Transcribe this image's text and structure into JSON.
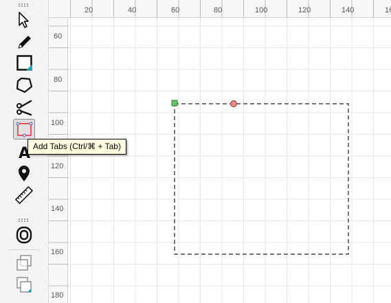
{
  "tooltip": {
    "text": "Add Tabs (Ctrl/⌘ + Tab)"
  },
  "ruler": {
    "x_ticks": [
      "20",
      "40",
      "60",
      "80",
      "100",
      "120",
      "140",
      "16"
    ],
    "y_ticks": [
      "60",
      "80",
      "100",
      "120",
      "140",
      "160",
      "180"
    ]
  },
  "toolbar": {
    "tools": [
      {
        "icon": "select-arrow-icon"
      },
      {
        "icon": "pencil-icon"
      },
      {
        "icon": "rectangle-icon"
      },
      {
        "icon": "polygon-icon"
      },
      {
        "icon": "scissors-icon"
      },
      {
        "icon": "add-tabs-icon",
        "active": true
      },
      {
        "icon": "text-icon"
      },
      {
        "icon": "map-pin-icon"
      },
      {
        "icon": "ruler-icon"
      },
      {
        "icon": "offset-icon"
      },
      {
        "icon": "union-icon"
      },
      {
        "icon": "difference-icon"
      }
    ]
  },
  "colors": {
    "start_handle": "#6ac46a",
    "midpoint_handle": "#f08a8a",
    "tab_icon_accent": "#e0303a",
    "tooltip_bg": "#ffffe1"
  }
}
